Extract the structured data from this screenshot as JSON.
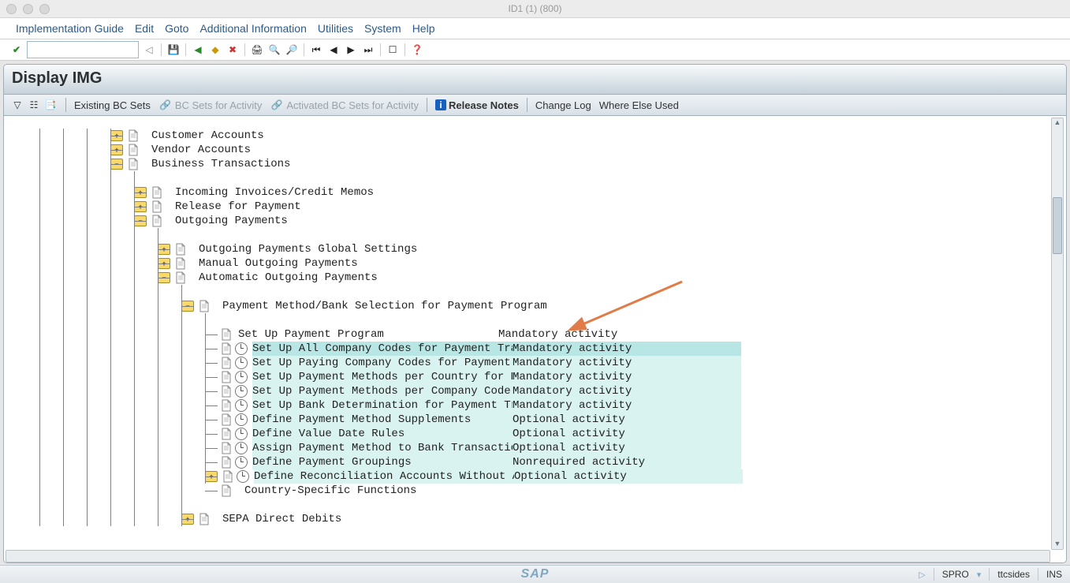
{
  "window": {
    "title": "ID1 (1) (800)"
  },
  "menubar": [
    "Implementation Guide",
    "Edit",
    "Goto",
    "Additional Information",
    "Utilities",
    "System",
    "Help"
  ],
  "panel": {
    "title": "Display IMG"
  },
  "apptoolbar": {
    "existing": "Existing BC Sets",
    "bcActivity": "BC Sets for Activity",
    "activated": "Activated BC Sets for Activity",
    "release": "Release Notes",
    "changeLog": "Change Log",
    "whereElse": "Where Else Used"
  },
  "statusbar": {
    "tcode": "SPRO",
    "user": "ttcsides",
    "ins": "INS",
    "sap": "SAP"
  },
  "tree": {
    "items": [
      {
        "indent": 4,
        "folder": "plus",
        "doc": true,
        "clock": false,
        "label": "Customer Accounts",
        "activity": "",
        "connectors": [
          1,
          2,
          3,
          4
        ],
        "tee": 4,
        "hl": ""
      },
      {
        "indent": 4,
        "folder": "plus",
        "doc": true,
        "clock": false,
        "label": "Vendor Accounts",
        "activity": "",
        "connectors": [
          1,
          2,
          3,
          4
        ],
        "tee": 4,
        "hl": ""
      },
      {
        "indent": 4,
        "folder": "minus",
        "doc": true,
        "clock": false,
        "label": "Business Transactions",
        "activity": "",
        "connectors": [
          1,
          2,
          3,
          4
        ],
        "tee": 4,
        "hl": ""
      },
      {
        "indent": 5,
        "folder": "",
        "doc": false,
        "clock": false,
        "label": "",
        "activity": "",
        "connectors": [
          1,
          2,
          3,
          4,
          5
        ],
        "tee": 0,
        "hl": "",
        "spacer": true
      },
      {
        "indent": 5,
        "folder": "plus",
        "doc": true,
        "clock": false,
        "label": "Incoming Invoices/Credit Memos",
        "activity": "",
        "connectors": [
          1,
          2,
          3,
          4,
          5
        ],
        "tee": 5,
        "hl": ""
      },
      {
        "indent": 5,
        "folder": "plus",
        "doc": true,
        "clock": false,
        "label": "Release for Payment",
        "activity": "",
        "connectors": [
          1,
          2,
          3,
          4,
          5
        ],
        "tee": 5,
        "hl": ""
      },
      {
        "indent": 5,
        "folder": "minus",
        "doc": true,
        "clock": false,
        "label": "Outgoing Payments",
        "activity": "",
        "connectors": [
          1,
          2,
          3,
          4,
          5
        ],
        "tee": 5,
        "hl": ""
      },
      {
        "indent": 6,
        "folder": "",
        "doc": false,
        "clock": false,
        "label": "",
        "activity": "",
        "connectors": [
          1,
          2,
          3,
          4,
          5,
          6
        ],
        "tee": 0,
        "hl": "",
        "spacer": true
      },
      {
        "indent": 6,
        "folder": "plus",
        "doc": true,
        "clock": false,
        "label": "Outgoing Payments Global Settings",
        "activity": "",
        "connectors": [
          1,
          2,
          3,
          4,
          5,
          6
        ],
        "tee": 6,
        "hl": ""
      },
      {
        "indent": 6,
        "folder": "plus",
        "doc": true,
        "clock": false,
        "label": "Manual Outgoing Payments",
        "activity": "",
        "connectors": [
          1,
          2,
          3,
          4,
          5,
          6
        ],
        "tee": 6,
        "hl": ""
      },
      {
        "indent": 6,
        "folder": "minus",
        "doc": true,
        "clock": false,
        "label": "Automatic Outgoing Payments",
        "activity": "",
        "connectors": [
          1,
          2,
          3,
          4,
          5,
          6
        ],
        "tee": 6,
        "hl": ""
      },
      {
        "indent": 7,
        "folder": "",
        "doc": false,
        "clock": false,
        "label": "",
        "activity": "",
        "connectors": [
          1,
          2,
          3,
          4,
          5,
          6,
          7
        ],
        "tee": 0,
        "hl": "",
        "spacer": true
      },
      {
        "indent": 7,
        "folder": "minus",
        "doc": true,
        "clock": false,
        "label": "Payment Method/Bank Selection for Payment Program",
        "activity": "",
        "connectors": [
          1,
          2,
          3,
          4,
          5,
          6,
          7
        ],
        "tee": 7,
        "hl": ""
      },
      {
        "indent": 8,
        "folder": "",
        "doc": false,
        "clock": false,
        "label": "",
        "activity": "",
        "connectors": [
          1,
          2,
          3,
          4,
          5,
          6,
          7,
          8
        ],
        "tee": 0,
        "hl": "",
        "spacer": true
      },
      {
        "indent": 8,
        "folder": "",
        "doc": true,
        "clock": false,
        "label": "Set Up Payment Program",
        "activity": "Mandatory activity",
        "connectors": [
          1,
          2,
          3,
          4,
          5,
          6,
          7,
          8
        ],
        "tee": 8,
        "hl": ""
      },
      {
        "indent": 8,
        "folder": "",
        "doc": true,
        "clock": true,
        "label": "Set Up All Company Codes for Payment Transactions",
        "activity": "Mandatory activity",
        "connectors": [
          1,
          2,
          3,
          4,
          5,
          6,
          7,
          8
        ],
        "tee": 8,
        "hl": "strong"
      },
      {
        "indent": 8,
        "folder": "",
        "doc": true,
        "clock": true,
        "label": "Set Up Paying Company Codes for Payment Transactions",
        "activity": "Mandatory activity",
        "connectors": [
          1,
          2,
          3,
          4,
          5,
          6,
          7,
          8
        ],
        "tee": 8,
        "hl": "soft"
      },
      {
        "indent": 8,
        "folder": "",
        "doc": true,
        "clock": true,
        "label": "Set Up Payment Methods per Country for Payment Tran",
        "activity": "Mandatory activity",
        "connectors": [
          1,
          2,
          3,
          4,
          5,
          6,
          7,
          8
        ],
        "tee": 8,
        "hl": "soft"
      },
      {
        "indent": 8,
        "folder": "",
        "doc": true,
        "clock": true,
        "label": "Set Up Payment Methods per Company Code for Payment",
        "activity": "Mandatory activity",
        "connectors": [
          1,
          2,
          3,
          4,
          5,
          6,
          7,
          8
        ],
        "tee": 8,
        "hl": "soft"
      },
      {
        "indent": 8,
        "folder": "",
        "doc": true,
        "clock": true,
        "label": "Set Up Bank Determination for Payment Transactions",
        "activity": "Mandatory activity",
        "connectors": [
          1,
          2,
          3,
          4,
          5,
          6,
          7,
          8
        ],
        "tee": 8,
        "hl": "soft"
      },
      {
        "indent": 8,
        "folder": "",
        "doc": true,
        "clock": true,
        "label": "Define Payment Method Supplements",
        "activity": "Optional activity",
        "connectors": [
          1,
          2,
          3,
          4,
          5,
          6,
          7,
          8
        ],
        "tee": 8,
        "hl": "soft"
      },
      {
        "indent": 8,
        "folder": "",
        "doc": true,
        "clock": true,
        "label": "Define Value Date Rules",
        "activity": "Optional activity",
        "connectors": [
          1,
          2,
          3,
          4,
          5,
          6,
          7,
          8
        ],
        "tee": 8,
        "hl": "soft"
      },
      {
        "indent": 8,
        "folder": "",
        "doc": true,
        "clock": true,
        "label": "Assign Payment Method to Bank Transaction",
        "activity": "Optional activity",
        "connectors": [
          1,
          2,
          3,
          4,
          5,
          6,
          7,
          8
        ],
        "tee": 8,
        "hl": "soft"
      },
      {
        "indent": 8,
        "folder": "",
        "doc": true,
        "clock": true,
        "label": "Define Payment Groupings",
        "activity": "Nonrequired activity",
        "connectors": [
          1,
          2,
          3,
          4,
          5,
          6,
          7,
          8
        ],
        "tee": 8,
        "hl": "soft"
      },
      {
        "indent": 8,
        "folder": "plus",
        "doc": true,
        "clock": true,
        "label": "Define Reconciliation Accounts Without Auto",
        "activity": "Optional activity",
        "connectors": [
          1,
          2,
          3,
          4,
          5,
          6,
          7,
          8
        ],
        "tee": 8,
        "hl": "soft"
      },
      {
        "indent": 8,
        "folder": "",
        "doc": true,
        "clock": false,
        "label": "Country-Specific Functions",
        "activity": "",
        "connectors": [
          1,
          2,
          3,
          4,
          5,
          6,
          7
        ],
        "tee": 8,
        "last": true,
        "hl": ""
      },
      {
        "indent": 7,
        "folder": "",
        "doc": false,
        "clock": false,
        "label": "",
        "activity": "",
        "connectors": [
          1,
          2,
          3,
          4,
          5,
          6,
          7
        ],
        "tee": 0,
        "hl": "",
        "spacer": true
      },
      {
        "indent": 7,
        "folder": "plus",
        "doc": true,
        "clock": false,
        "label": "SEPA Direct Debits",
        "activity": "",
        "connectors": [
          1,
          2,
          3,
          4,
          5,
          6,
          7
        ],
        "tee": 7,
        "hl": ""
      }
    ]
  }
}
